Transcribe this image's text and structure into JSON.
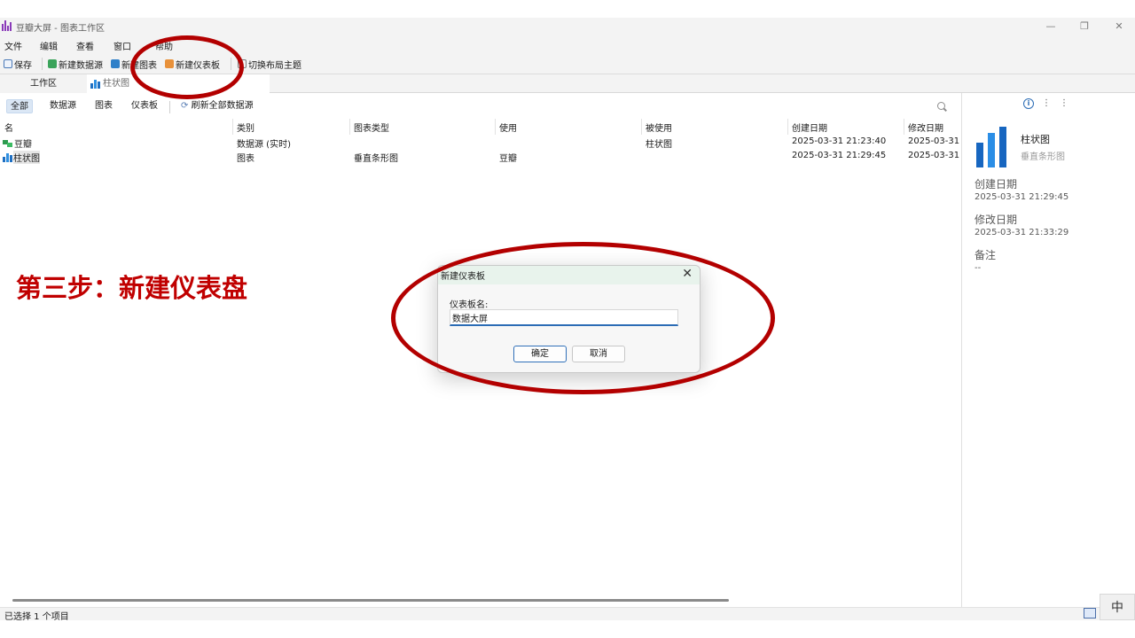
{
  "app": {
    "title": "豆瓣大屏 - 图表工作区",
    "accent_color": "#8a3ab9",
    "window_controls": [
      "—",
      "❐",
      "✕"
    ]
  },
  "menubar": {
    "items": [
      "文件",
      "编辑",
      "查看",
      "窗口",
      "帮助"
    ]
  },
  "toolbar": {
    "save": "保存",
    "new_datasource": "新建数据源",
    "new_chart": "新建图表",
    "new_dashboard": "新建仪表板",
    "switch_theme": "切换布局主题"
  },
  "tabs": {
    "workspace": "工作区",
    "chart": "柱状图"
  },
  "filters": {
    "all": "全部",
    "datasource": "数据源",
    "chart": "图表",
    "dashboard": "仪表板",
    "refresh_all": "刷新全部数据源"
  },
  "table": {
    "columns": [
      "名",
      "类别",
      "图表类型",
      "使用",
      "被使用",
      "创建日期",
      "修改日期"
    ],
    "rows": [
      {
        "name": "豆瓣",
        "category": "数据源 (实时)",
        "chart_type": "",
        "uses": "",
        "used_by": "柱状图",
        "created": "2025-03-31 21:23:40",
        "modified": "2025-03-31",
        "icon": "datasource-icon"
      },
      {
        "name": "柱状图",
        "category": "图表",
        "chart_type": "垂直条形图",
        "uses": "豆瓣",
        "used_by": "",
        "created": "2025-03-31 21:29:45",
        "modified": "2025-03-31",
        "icon": "bar-chart-icon"
      }
    ]
  },
  "sidepanel": {
    "item_name": "柱状图",
    "item_type": "垂直条形图",
    "created_label": "创建日期",
    "created_value": "2025-03-31 21:29:45",
    "modified_label": "修改日期",
    "modified_value": "2025-03-31 21:33:29",
    "notes_label": "备注",
    "notes_value": "--"
  },
  "status": {
    "selection": "已选择 1 个项目",
    "ime": "中"
  },
  "annotation": {
    "step_title": "第三步：新建仪表盘",
    "color": "#b30000"
  },
  "dialog": {
    "title": "新建仪表板",
    "close": "✕",
    "field_label": "仪表板名:",
    "field_value": "数据大屏",
    "ok": "确定",
    "cancel": "取消"
  }
}
